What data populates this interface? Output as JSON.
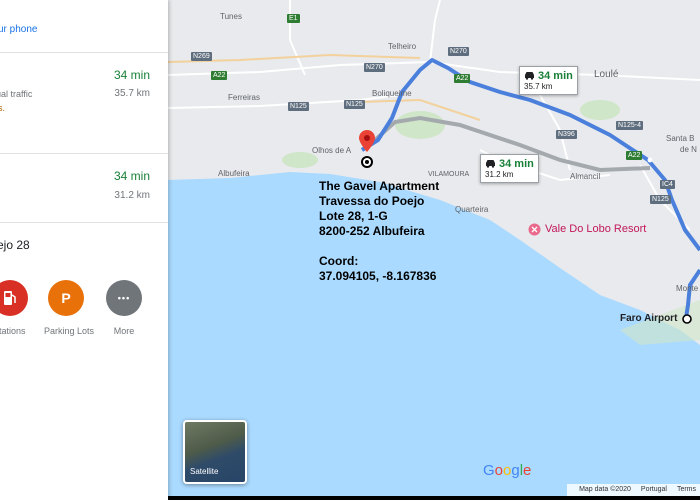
{
  "panel": {
    "phone_link": "ur phone",
    "routes": [
      {
        "time": "34 min",
        "distance": "35.7 km",
        "note": "ual traffic",
        "note2": "s."
      },
      {
        "time": "34 min",
        "distance": "31.2 km"
      }
    ],
    "address_line": "ejo 28",
    "nearby": [
      {
        "label": "stations",
        "icon": "gas-station-icon",
        "color": "#d93025"
      },
      {
        "label": "Parking Lots",
        "icon": "parking-icon",
        "glyph": "P",
        "color": "#e8710a"
      },
      {
        "label": "More",
        "icon": "more-icon",
        "glyph": "•••",
        "color": "#70757a"
      }
    ]
  },
  "map": {
    "places": {
      "tunes": "Tunes",
      "ferreiras": "Ferreiras",
      "telheiro": "Telheiro",
      "boliqueime": "Boliqueime",
      "loule": "Loulé",
      "olhos": "Olhos de A",
      "albufeira": "Albufeira",
      "vilamoura": "VILAMOURA",
      "quarteira": "Quarteira",
      "almancil": "Almancil",
      "santa": "Santa B",
      "santa2": "de N",
      "monte": "Monte"
    },
    "roads": {
      "e1": "E1",
      "n269": "N269",
      "n270a": "N270",
      "n270b": "N270",
      "a22a": "A22",
      "a22b": "A22",
      "a22c": "A22",
      "n125a": "N125",
      "n125b": "N125",
      "n396": "N396",
      "n125_4": "N125-4",
      "ic4": "IC4",
      "n125c": "N125"
    },
    "route_boxes": [
      {
        "time": "34 min",
        "distance": "35.7 km"
      },
      {
        "time": "34 min",
        "distance": "31.2 km"
      }
    ],
    "poi": {
      "vale_do_lobo": "Vale Do Lobo Resort",
      "faro_airport": "Faro Airport"
    },
    "annotation": "The Gavel Apartment\nTravessa do Poejo\nLote 28, 1-G\n8200-252 Albufeira\n\nCoord:\n37.094105, -8.167836",
    "satellite_label": "Satellite",
    "logo": "Google",
    "attribution": {
      "data": "Map data ©2020",
      "region": "Portugal",
      "terms": "Terms"
    },
    "colors": {
      "land": "#e8eaed",
      "sea": "#aadaff",
      "route_primary": "#4a7fdc",
      "route_alt": "#a4a9ae",
      "pin": "#ea4335"
    }
  }
}
